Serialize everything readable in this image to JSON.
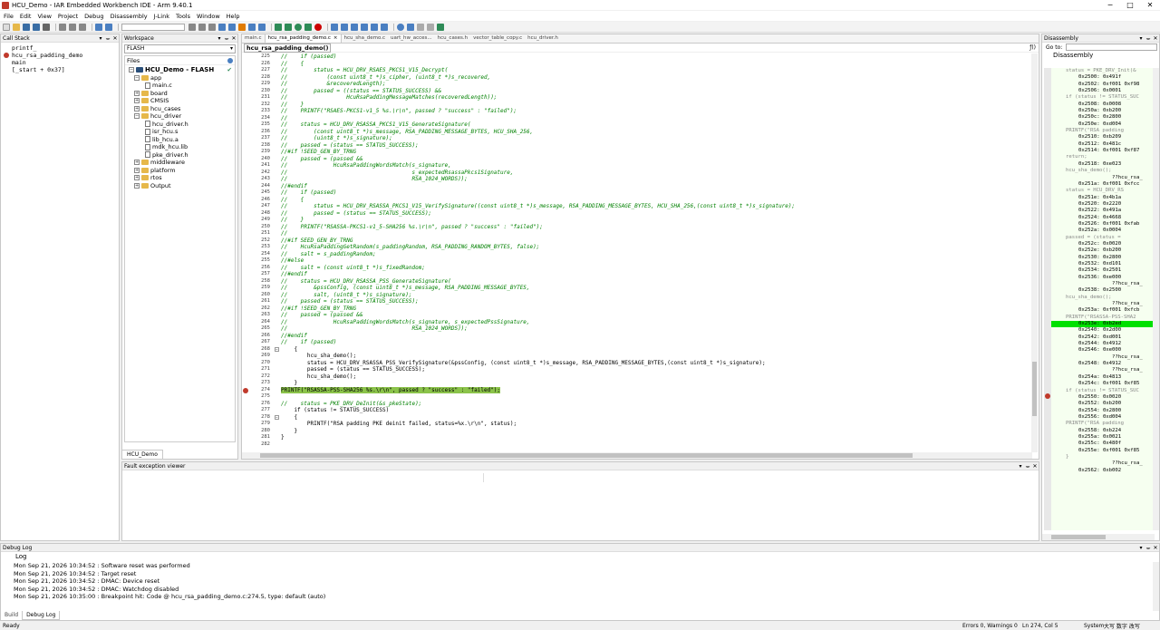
{
  "window": {
    "title": "HCU_Demo - IAR Embedded Workbench IDE - Arm 9.40.1",
    "min": "─",
    "max": "□",
    "close": "✕"
  },
  "menu": [
    "File",
    "Edit",
    "View",
    "Project",
    "Debug",
    "Disassembly",
    "J-Link",
    "Tools",
    "Window",
    "Help"
  ],
  "callstack": {
    "title": "Call Stack",
    "lines": [
      "printf_",
      "hcu_rsa_padding_demo",
      "main",
      "[_start + 0x37]"
    ]
  },
  "workspace": {
    "title": "Workspace",
    "config": "FLASH",
    "files_label": "Files",
    "tab": "HCU_Demo",
    "tree": [
      {
        "label": "HCU_Demo - FLASH",
        "type": "project"
      },
      {
        "label": "app",
        "type": "folder"
      },
      {
        "label": "main.c",
        "type": "file"
      },
      {
        "label": "board",
        "type": "folder"
      },
      {
        "label": "CMSIS",
        "type": "folder"
      },
      {
        "label": "hcu_cases",
        "type": "folder"
      },
      {
        "label": "hcu_driver",
        "type": "folder"
      },
      {
        "label": "hcu_driver.h",
        "type": "file"
      },
      {
        "label": "isr_hcu.s",
        "type": "file"
      },
      {
        "label": "lib_hcu.a",
        "type": "file"
      },
      {
        "label": "mdk_hcu.lib",
        "type": "file"
      },
      {
        "label": "pke_driver.h",
        "type": "file"
      },
      {
        "label": "middleware",
        "type": "folder"
      },
      {
        "label": "platform",
        "type": "folder"
      },
      {
        "label": "rtos",
        "type": "folder"
      },
      {
        "label": "Output",
        "type": "folder"
      }
    ]
  },
  "editor": {
    "tabs": [
      "main.c",
      "hcu_rsa_padding_demo.c",
      "hcu_sha_demo.c",
      "uart_hw_acces...",
      "hcu_cases.h",
      "vector_table_copy.c",
      "hcu_driver.h"
    ],
    "close_icon": "×",
    "function_combo": "hcu_rsa_padding_demo()",
    "lines": [
      {
        "n": "225",
        "t": "//    if (passed)",
        "c": "cm"
      },
      {
        "n": "226",
        "t": "//    {",
        "c": "cm"
      },
      {
        "n": "227",
        "t": "//        status = HCU_DRV_RSAES_PKCS1_V15_Decrypt(",
        "c": "cm"
      },
      {
        "n": "228",
        "t": "//            (const uint8_t *)s_cipher, (uint8_t *)s_recovered,",
        "c": "cm"
      },
      {
        "n": "229",
        "t": "//            &recoveredLength);",
        "c": "cm"
      },
      {
        "n": "230",
        "t": "//        passed = ((status == STATUS_SUCCESS) &&",
        "c": "cm"
      },
      {
        "n": "231",
        "t": "//                  HcuRsaPaddingMessageMatches(recoveredLength));",
        "c": "cm"
      },
      {
        "n": "232",
        "t": "//    }",
        "c": "cm"
      },
      {
        "n": "233",
        "t": "//    PRINTF(\"RSAES-PKCS1-v1_5 %s.\\r\\n\", passed ? \"success\" : \"failed\");",
        "c": "cm"
      },
      {
        "n": "234",
        "t": "//",
        "c": "cm"
      },
      {
        "n": "235",
        "t": "//    status = HCU_DRV_RSASSA_PKCS1_V15_GenerateSignature(",
        "c": "cm"
      },
      {
        "n": "236",
        "t": "//        (const uint8_t *)s_message, RSA_PADDING_MESSAGE_BYTES, HCU_SHA_256,",
        "c": "cm"
      },
      {
        "n": "237",
        "t": "//        (uint8_t *)s_signature);",
        "c": "cm"
      },
      {
        "n": "238",
        "t": "//    passed = (status == STATUS_SUCCESS);",
        "c": "cm"
      },
      {
        "n": "239",
        "t": "//#if !SEED_GEN_BY_TRNG",
        "c": "cm"
      },
      {
        "n": "240",
        "t": "//    passed = (passed &&",
        "c": "cm"
      },
      {
        "n": "241",
        "t": "//              HcuRsaPaddingWordsMatch(s_signature,",
        "c": "cm"
      },
      {
        "n": "242",
        "t": "//                                      s_expectedRsassaPkcs1Signature,",
        "c": "cm"
      },
      {
        "n": "243",
        "t": "//                                      RSA_1024_WORDS));",
        "c": "cm"
      },
      {
        "n": "244",
        "t": "//#endif",
        "c": "cm"
      },
      {
        "n": "245",
        "t": "//    if (passed)",
        "c": "cm"
      },
      {
        "n": "246",
        "t": "//    {",
        "c": "cm"
      },
      {
        "n": "247",
        "t": "//        status = HCU_DRV_RSASSA_PKCS1_V15_VerifySignature((const uint8_t *)s_message, RSA_PADDING_MESSAGE_BYTES, HCU_SHA_256,(const uint8_t *)s_signature);",
        "c": "cm"
      },
      {
        "n": "248",
        "t": "//        passed = (status == STATUS_SUCCESS);",
        "c": "cm"
      },
      {
        "n": "249",
        "t": "//    }",
        "c": "cm"
      },
      {
        "n": "250",
        "t": "//    PRINTF(\"RSASSA-PKCS1-v1_5-SHA256 %s.\\r\\n\", passed ? \"success\" : \"failed\");",
        "c": "cm"
      },
      {
        "n": "251",
        "t": "//",
        "c": "cm"
      },
      {
        "n": "252",
        "t": "//#if SEED_GEN_BY_TRNG",
        "c": "cm"
      },
      {
        "n": "253",
        "t": "//    HcuRsaPaddingGetRandom(s_paddingRandom, RSA_PADDING_RANDOM_BYTES, false);",
        "c": "cm"
      },
      {
        "n": "254",
        "t": "//    salt = s_paddingRandom;",
        "c": "cm"
      },
      {
        "n": "255",
        "t": "//#else",
        "c": "cm"
      },
      {
        "n": "256",
        "t": "//    salt = (const uint8_t *)s_fixedRandom;",
        "c": "cm"
      },
      {
        "n": "257",
        "t": "//#endif",
        "c": "cm"
      },
      {
        "n": "258",
        "t": "//    status = HCU_DRV_RSASSA_PSS_GenerateSignature(",
        "c": "cm"
      },
      {
        "n": "259",
        "t": "//        &pssConfig, (const uint8_t *)s_message, RSA_PADDING_MESSAGE_BYTES,",
        "c": "cm"
      },
      {
        "n": "260",
        "t": "//        salt, (uint8_t *)s_signature);",
        "c": "cm"
      },
      {
        "n": "261",
        "t": "//    passed = (status == STATUS_SUCCESS);",
        "c": "cm"
      },
      {
        "n": "262",
        "t": "//#if !SEED_GEN_BY_TRNG",
        "c": "cm"
      },
      {
        "n": "263",
        "t": "//    passed = (passed &&",
        "c": "cm"
      },
      {
        "n": "264",
        "t": "//              HcuRsaPaddingWordsMatch(s_signature, s_expectedPssSignature,",
        "c": "cm"
      },
      {
        "n": "265",
        "t": "//                                      RSA_1024_WORDS));",
        "c": "cm"
      },
      {
        "n": "266",
        "t": "//#endif",
        "c": "cm"
      },
      {
        "n": "267",
        "t": "//    if (passed)",
        "c": "cm"
      },
      {
        "n": "268",
        "t": "    {",
        "c": "",
        "fold": true
      },
      {
        "n": "269",
        "t": "        hcu_sha_demo();",
        "c": ""
      },
      {
        "n": "270",
        "t": "        status = HCU_DRV_RSASSA_PSS_VerifySignature(&pssConfig, (const uint8_t *)s_message, RSA_PADDING_MESSAGE_BYTES,(const uint8_t *)s_signature);",
        "c": ""
      },
      {
        "n": "271",
        "t": "        passed = (status == STATUS_SUCCESS);",
        "c": ""
      },
      {
        "n": "272",
        "t": "        hcu_sha_demo();",
        "c": ""
      },
      {
        "n": "273",
        "t": "    }",
        "c": ""
      },
      {
        "n": "274",
        "t": "PRINTF(\"RSASSA-PSS-SHA256 %s.\\r\\n\", passed ? \"success\" : \"failed\");",
        "c": "hl",
        "bp": true
      },
      {
        "n": "275",
        "t": "",
        "c": ""
      },
      {
        "n": "276",
        "t": "//    status = PKE_DRV_DeInit(&s_pkeState);",
        "c": "cm"
      },
      {
        "n": "277",
        "t": "    if (status != STATUS_SUCCESS)",
        "c": ""
      },
      {
        "n": "278",
        "t": "    {",
        "c": "",
        "fold": true
      },
      {
        "n": "279",
        "t": "        PRINTF(\"RSA padding PKE deinit failed, status=%x.\\r\\n\", status);",
        "c": ""
      },
      {
        "n": "280",
        "t": "    }",
        "c": ""
      },
      {
        "n": "281",
        "t": "}",
        "c": ""
      },
      {
        "n": "282",
        "t": "",
        "c": ""
      }
    ]
  },
  "fault": {
    "title": "Fault exception viewer"
  },
  "disassembly": {
    "title": "Disassembly",
    "goto_label": "Go to:",
    "header": "Disassembly",
    "lines": [
      {
        "t": "status = PKE_DRV_Init(&",
        "k": "src"
      },
      {
        "t": "0x2500: 0x491f",
        "k": ""
      },
      {
        "t": "0x2502: 0xf001 0xf98",
        "k": ""
      },
      {
        "t": "0x2506: 0x0001",
        "k": ""
      },
      {
        "t": "if (status != STATUS_SUC",
        "k": "src"
      },
      {
        "t": "0x2508: 0x0008",
        "k": ""
      },
      {
        "t": "0x250a: 0xb200",
        "k": ""
      },
      {
        "t": "0x250c: 0x2800",
        "k": ""
      },
      {
        "t": "0x250e: 0xd004",
        "k": ""
      },
      {
        "t": "PRINTF(\"RSA padding",
        "k": "src"
      },
      {
        "t": "0x2510: 0xb209",
        "k": ""
      },
      {
        "t": "0x2512: 0x481c",
        "k": ""
      },
      {
        "t": "0x2514: 0xf001 0xf87",
        "k": ""
      },
      {
        "t": "return;",
        "k": "src"
      },
      {
        "t": "0x2518: 0xe023",
        "k": ""
      },
      {
        "t": "hcu_sha_demo();",
        "k": "src"
      },
      {
        "t": "           ??hcu_rsa_",
        "k": ""
      },
      {
        "t": "0x251a: 0xf001 0xfcc",
        "k": ""
      },
      {
        "t": "status = HCU_DRV_RS",
        "k": "src"
      },
      {
        "t": "0x251e: 0x4b1a",
        "k": ""
      },
      {
        "t": "0x2520: 0x2220",
        "k": ""
      },
      {
        "t": "0x2522: 0x491a",
        "k": ""
      },
      {
        "t": "0x2524: 0x4668",
        "k": ""
      },
      {
        "t": "0x2526: 0xf001 0xfab",
        "k": ""
      },
      {
        "t": "0x252a: 0x0004",
        "k": ""
      },
      {
        "t": "passed = (status =",
        "k": "src"
      },
      {
        "t": "0x252c: 0x0020",
        "k": ""
      },
      {
        "t": "0x252e: 0xb200",
        "k": ""
      },
      {
        "t": "0x2530: 0x2800",
        "k": ""
      },
      {
        "t": "0x2532: 0xd101",
        "k": ""
      },
      {
        "t": "0x2534: 0x2501",
        "k": ""
      },
      {
        "t": "0x2536: 0xe000",
        "k": ""
      },
      {
        "t": "           ??hcu_rsa_",
        "k": ""
      },
      {
        "t": "0x2538: 0x2500",
        "k": ""
      },
      {
        "t": "hcu_sha_demo();",
        "k": "src"
      },
      {
        "t": "           ??hcu_rsa_",
        "k": ""
      },
      {
        "t": "0x253a: 0xf001 0xfcb",
        "k": ""
      },
      {
        "t": "PRINTF(\"RSASSA-PSS-SHA2",
        "k": "src"
      },
      {
        "t": "0x253e: 0xb2ed",
        "k": "cur"
      },
      {
        "t": "0x2540: 0x2d00",
        "k": ""
      },
      {
        "t": "0x2542: 0xd001",
        "k": ""
      },
      {
        "t": "0x2544: 0x4912",
        "k": ""
      },
      {
        "t": "0x2546: 0xe000",
        "k": ""
      },
      {
        "t": "           ??hcu_rsa_",
        "k": ""
      },
      {
        "t": "0x2548: 0x4912",
        "k": ""
      },
      {
        "t": "           ??hcu_rsa_",
        "k": ""
      },
      {
        "t": "0x254a: 0x4813",
        "k": ""
      },
      {
        "t": "0x254c: 0xf001 0xf85",
        "k": ""
      },
      {
        "t": "if (status != STATUS_SUC",
        "k": "src"
      },
      {
        "t": "0x2550: 0x0020",
        "k": ""
      },
      {
        "t": "0x2552: 0xb200",
        "k": ""
      },
      {
        "t": "0x2554: 0x2800",
        "k": ""
      },
      {
        "t": "0x2556: 0xd004",
        "k": ""
      },
      {
        "t": "PRINTF(\"RSA padding",
        "k": "src"
      },
      {
        "t": "0x2558: 0xb224",
        "k": ""
      },
      {
        "t": "0x255a: 0x0021",
        "k": ""
      },
      {
        "t": "0x255c: 0x480f",
        "k": ""
      },
      {
        "t": "0x255e: 0xf001 0xf85",
        "k": ""
      },
      {
        "t": "}",
        "k": "src"
      },
      {
        "t": "           ??hcu_rsa_",
        "k": ""
      },
      {
        "t": "0x2562: 0xb002",
        "k": ""
      }
    ]
  },
  "debuglog": {
    "title": "Debug Log",
    "header": "Log",
    "lines": [
      "Mon Sep 21, 2026 10:34:52 : Software reset was performed",
      "Mon Sep 21, 2026 10:34:52 : Target reset",
      "Mon Sep 21, 2026 10:34:52 : DMAC: Device reset",
      "Mon Sep 21, 2026 10:34:52 : DMAC: Watchdog disabled",
      "Mon Sep 21, 2026 10:35:00 : Breakpoint hit: Code @ hcu_rsa_padding_demo.c:274.5, type: default (auto)"
    ],
    "tabs": [
      "Build",
      "Debug Log"
    ]
  },
  "status": {
    "left": "Ready",
    "errors": "Errors 0, Warnings 0",
    "pos": "Ln 274, Col 5",
    "enc": "System",
    "ime": "大写 数字 改写"
  },
  "colors": {
    "accent": "#8bc34a",
    "current_line": "#00e000",
    "breakpoint": "#c0392b",
    "comment": "#008000"
  }
}
